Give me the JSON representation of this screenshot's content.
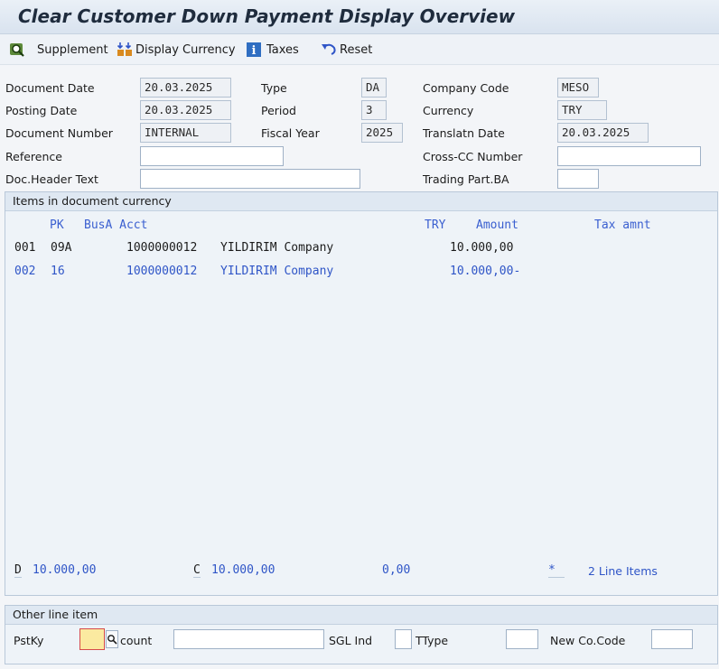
{
  "title": "Clear Customer Down Payment Display Overview",
  "toolbar": {
    "supplement": "Supplement",
    "display_currency": "Display Currency",
    "taxes": "Taxes",
    "reset": "Reset"
  },
  "header": {
    "doc_date_label": "Document Date",
    "doc_date": "20.03.2025",
    "type_label": "Type",
    "type": "DA",
    "company_code_label": "Company Code",
    "company_code": "MESO",
    "posting_date_label": "Posting Date",
    "posting_date": "20.03.2025",
    "period_label": "Period",
    "period": "3",
    "currency_label": "Currency",
    "currency": "TRY",
    "doc_number_label": "Document Number",
    "doc_number": "INTERNAL",
    "fiscal_year_label": "Fiscal Year",
    "fiscal_year": "2025",
    "translatn_label": "Translatn Date",
    "translatn_date": "20.03.2025",
    "reference_label": "Reference",
    "reference": "",
    "cross_cc_label": "Cross-CC Number",
    "cross_cc": "",
    "header_text_label": "Doc.Header Text",
    "header_text": "",
    "trading_part_label": "Trading Part.BA",
    "trading_part": ""
  },
  "items": {
    "group_title": "Items in document currency",
    "col_pk": "PK",
    "col_busa_acct": "BusA Acct",
    "col_currency": "TRY",
    "col_amount": "Amount",
    "col_tax": "Tax amnt",
    "rows": [
      {
        "no": "001",
        "pk": "09A",
        "acct": "1000000012",
        "name": "YILDIRIM Company",
        "amount": "10.000,00"
      },
      {
        "no": "002",
        "pk": "16",
        "acct": "1000000012",
        "name": "YILDIRIM Company",
        "amount": "10.000,00-"
      }
    ],
    "totals": {
      "d_label": "D",
      "d_value": "10.000,00",
      "c_label": "C",
      "c_value": "10.000,00",
      "balance": "0,00",
      "star": "*",
      "line_items": "2 Line Items"
    }
  },
  "other": {
    "group_title": "Other line item",
    "pstky_label": "PstKy",
    "account_label": "count",
    "sgl_label": "SGL Ind",
    "ttype_label": "TType",
    "new_cocode_label": "New Co.Code"
  }
}
